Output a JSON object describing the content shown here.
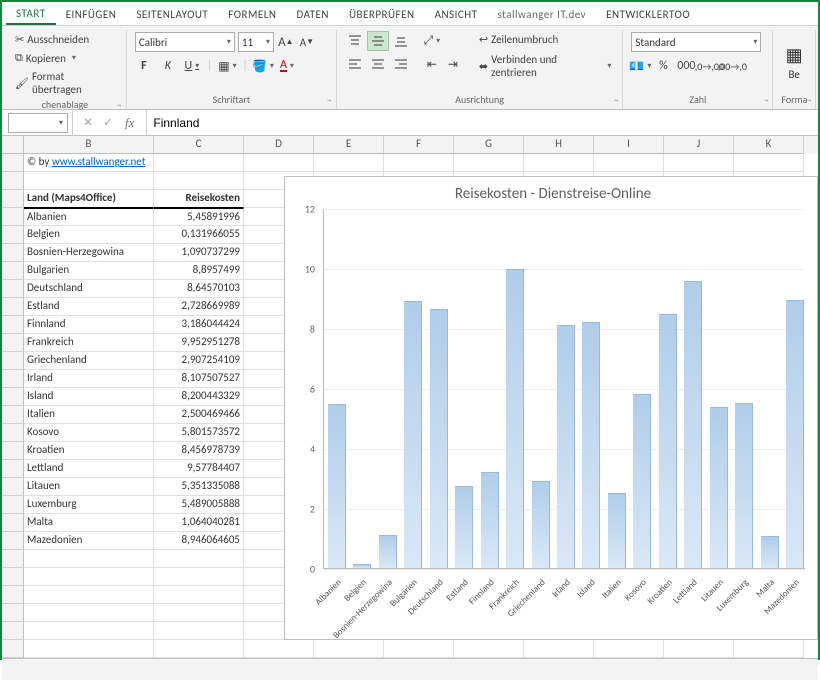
{
  "tabs": {
    "start": "START",
    "einfuegen": "EINFÜGEN",
    "seitenlayout": "SEITENLAYOUT",
    "formeln": "FORMELN",
    "daten": "DATEN",
    "ueberpruefen": "ÜBERPRÜFEN",
    "ansicht": "ANSICHT",
    "stallwanger": "stallwanger IT.dev",
    "entwicklertools": "ENTWICKLERTOO"
  },
  "clipboard": {
    "cut": "Ausschneiden",
    "copy": "Kopieren",
    "format_painter": "Format übertragen",
    "group_label": "chenablage"
  },
  "font": {
    "name": "Calibri",
    "size": "11",
    "bold": "F",
    "italic": "K",
    "underline": "U",
    "group_label": "Schriftart"
  },
  "alignment": {
    "wrap": "Zeilenumbruch",
    "merge": "Verbinden und zentrieren",
    "group_label": "Ausrichtung"
  },
  "number": {
    "format": "Standard",
    "group_label": "Zahl"
  },
  "be_group": {
    "be": "Be",
    "forma": "Forma"
  },
  "formula_bar": {
    "namebox": "",
    "value": "Finnland"
  },
  "columns": [
    "B",
    "C",
    "D",
    "E",
    "F",
    "G",
    "H",
    "I",
    "J",
    "K"
  ],
  "col_widths": {
    "B": 130,
    "C": 90,
    "D": 70,
    "E": 70,
    "F": 70,
    "G": 70,
    "H": 70,
    "I": 70,
    "J": 70,
    "K": 70
  },
  "copyright_prefix": "© by ",
  "copyright_link": "www.stallwanger.net",
  "headers": {
    "land": "Land (Maps4Office)",
    "reise": "Reisekosten"
  },
  "rows": [
    {
      "land": "Albanien",
      "val": "5,45891996"
    },
    {
      "land": "Belgien",
      "val": "0,131966055"
    },
    {
      "land": "Bosnien-Herzegowina",
      "val": "1,090737299"
    },
    {
      "land": "Bulgarien",
      "val": "8,8957499"
    },
    {
      "land": "Deutschland",
      "val": "8,64570103"
    },
    {
      "land": "Estland",
      "val": "2,728669989"
    },
    {
      "land": "Finnland",
      "val": "3,186044424"
    },
    {
      "land": "Frankreich",
      "val": "9,952951278"
    },
    {
      "land": "Griechenland",
      "val": "2,907254109"
    },
    {
      "land": "Irland",
      "val": "8,107507527"
    },
    {
      "land": "Island",
      "val": "8,200443329"
    },
    {
      "land": "Italien",
      "val": "2,500469466"
    },
    {
      "land": "Kosovo",
      "val": "5,801573572"
    },
    {
      "land": "Kroatien",
      "val": "8,456978739"
    },
    {
      "land": "Lettland",
      "val": "9,57784407"
    },
    {
      "land": "Litauen",
      "val": "5,351335088"
    },
    {
      "land": "Luxemburg",
      "val": "5,489005888"
    },
    {
      "land": "Malta",
      "val": "1,064040281"
    },
    {
      "land": "Mazedonien",
      "val": "8,946064605"
    }
  ],
  "chart_data": {
    "type": "bar",
    "title": "Reisekosten - Dienstreise-Online",
    "xlabel": "",
    "ylabel": "",
    "ylim": [
      0,
      12
    ],
    "yticks": [
      0,
      2,
      4,
      6,
      8,
      10,
      12
    ],
    "categories": [
      "Albanien",
      "Belgien",
      "Bosnien-Herzegowina",
      "Bulgarien",
      "Deutschland",
      "Estland",
      "Finnland",
      "Frankreich",
      "Griechenland",
      "Irland",
      "Island",
      "Italien",
      "Kosovo",
      "Kroatien",
      "Lettland",
      "Litauen",
      "Luxemburg",
      "Malta",
      "Mazedonien"
    ],
    "values": [
      5.459,
      0.132,
      1.091,
      8.896,
      8.646,
      2.729,
      3.186,
      9.953,
      2.907,
      8.108,
      8.2,
      2.5,
      5.802,
      8.457,
      9.578,
      5.351,
      5.489,
      1.064,
      8.946
    ]
  }
}
